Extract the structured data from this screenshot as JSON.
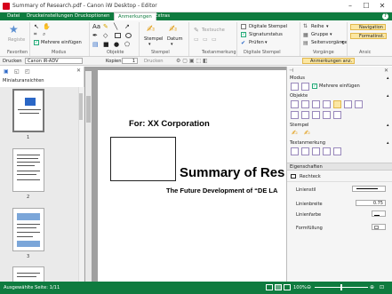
{
  "window": {
    "title": "Summary of Research.pdf - Canon iW Desktop - Editor",
    "minimize": "–",
    "maximize": "☐",
    "close": "✕"
  },
  "tabs": [
    "Datei",
    "Druckeinstellungen",
    "Druckoptionen",
    "Anmerkungen",
    "Extras"
  ],
  "ribbon": {
    "favoriten": {
      "label": "Favoriten",
      "registe": "Registe"
    },
    "modus": {
      "label": "Modus",
      "mehrere": "Mehrere einfügen"
    },
    "objekte": {
      "label": "Objekte"
    },
    "stempel": {
      "label": "Stempel",
      "stempel_btn": "Stempel",
      "datum_btn": "Datum"
    },
    "text": {
      "label": "Textanmerkung",
      "textsuche": "Textsuche"
    },
    "digital": {
      "label": "Digitale Stempel",
      "digitale": "Digitale Stempel",
      "signatur": "Signaturstatus",
      "prufen": "Prüfen"
    },
    "vorgaenge": {
      "label": "Vorgänge",
      "reihe": "Reihe",
      "gruppe": "Gruppe",
      "seite": "Seitenvorgänge"
    },
    "ansic": {
      "label": "Ansic",
      "navigation": "Navigation",
      "formatinst": "Formatinst."
    }
  },
  "statusline": {
    "drucken_label": "Drucken",
    "printer": "Canon iR-ADV",
    "kopien_label": "Kopien",
    "kopien": "1",
    "drucken_btn": "Drucken",
    "anmerkungen_btn": "Anmerkungen anz."
  },
  "leftpanel": {
    "title": "Miniaturansichten",
    "pages": [
      "1",
      "2",
      "3"
    ]
  },
  "page": {
    "for_text": "For: XX Corporation",
    "summary": "Summary of Res",
    "future": "The Future Development of “DE LA"
  },
  "rightpanel": {
    "modus": "Modus",
    "mehrere": "Mehrere einfügen",
    "objekte": "Objekte",
    "stempel": "Stempel",
    "textanmerkung": "Textanmerkung",
    "eigenschaften": "Eigenschaften",
    "rechteck": "Rechteck",
    "linienstil": "Linienstil",
    "linienbreite": "Linienbreite",
    "linienbreite_val": "0.75",
    "linienfarbe": "Linienfarbe",
    "formfuellung": "Formfüllung"
  },
  "statusbar": {
    "selected": "Ausgewählte Seite: 1/11",
    "zoom": "100%"
  },
  "colors": {
    "accent": "#0f7b3f",
    "active_tool": "#fbe7a3"
  }
}
